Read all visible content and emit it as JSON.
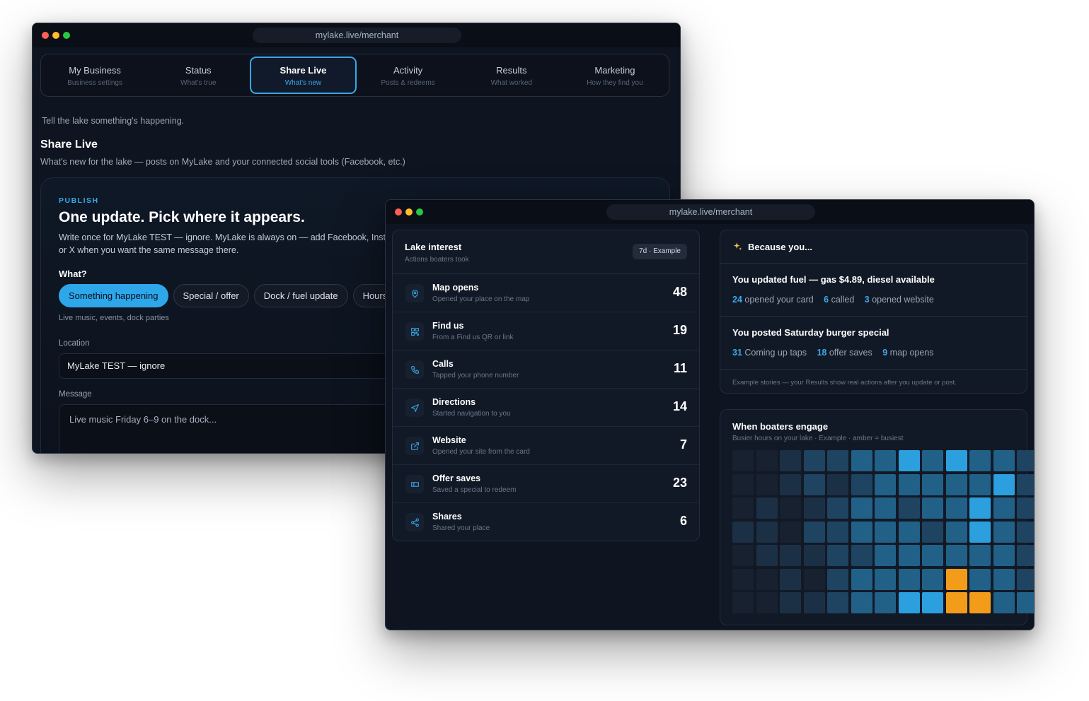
{
  "window1": {
    "url": "mylake.live/merchant",
    "tabs": [
      {
        "label": "My Business",
        "sub": "Business settings"
      },
      {
        "label": "Status",
        "sub": "What's true"
      },
      {
        "label": "Share Live",
        "sub": "What's new"
      },
      {
        "label": "Activity",
        "sub": "Posts & redeems"
      },
      {
        "label": "Results",
        "sub": "What worked"
      },
      {
        "label": "Marketing",
        "sub": "How they find you"
      }
    ],
    "active_tab": "Share Live",
    "tagline": "Tell the lake something's happening.",
    "title": "Share Live",
    "subtitle": "What's new for the lake — posts on MyLake and your connected social tools (Facebook, etc.)",
    "publish": {
      "kicker": "PUBLISH",
      "heading": "One update. Pick where it appears.",
      "desc_line1": "Write once for MyLake TEST — ignore. MyLake is always on — add Facebook, Insta",
      "desc_line2": "or X when you want the same message there.",
      "what_label": "What?",
      "chips": [
        "Something happening",
        "Special / offer",
        "Dock / fuel update",
        "Hours"
      ],
      "chip_hint": "Live music, events, dock parties",
      "location_label": "Location",
      "location_value": "MyLake TEST — ignore",
      "message_label": "Message",
      "message_placeholder": "Live music Friday 6–9 on the dock..."
    }
  },
  "window2": {
    "url": "mylake.live/merchant",
    "lake_interest": {
      "title": "Lake interest",
      "subtitle": "Actions boaters took",
      "badge": "7d · Example",
      "metrics": [
        {
          "icon": "map-pin-icon",
          "title": "Map opens",
          "sub": "Opened your place on the map",
          "value": "48"
        },
        {
          "icon": "qr-code-icon",
          "title": "Find us",
          "sub": "From a Find us QR or link",
          "value": "19"
        },
        {
          "icon": "phone-icon",
          "title": "Calls",
          "sub": "Tapped your phone number",
          "value": "11"
        },
        {
          "icon": "navigation-icon",
          "title": "Directions",
          "sub": "Started navigation to you",
          "value": "14"
        },
        {
          "icon": "external-link-icon",
          "title": "Website",
          "sub": "Opened your site from the card",
          "value": "7"
        },
        {
          "icon": "ticket-icon",
          "title": "Offer saves",
          "sub": "Saved a special to redeem",
          "value": "23"
        },
        {
          "icon": "share-icon",
          "title": "Shares",
          "sub": "Shared your place",
          "value": "6"
        }
      ]
    },
    "because": {
      "title": "Because you...",
      "stories": [
        {
          "title": "You updated fuel — gas $4.89, diesel available",
          "stats": [
            {
              "n": "24",
              "label": "opened your card"
            },
            {
              "n": "6",
              "label": "called"
            },
            {
              "n": "3",
              "label": "opened website"
            }
          ]
        },
        {
          "title": "You posted Saturday burger special",
          "stats": [
            {
              "n": "31",
              "label": "Coming up taps"
            },
            {
              "n": "18",
              "label": "offer saves"
            },
            {
              "n": "9",
              "label": "map opens"
            }
          ]
        }
      ],
      "footer": "Example stories — your Results show real actions after you update or post."
    },
    "engage": {
      "title": "When boaters engage",
      "subtitle": "Busier hours on your lake · Example · amber = busiest",
      "colors": {
        "0": "#111a27",
        "1": "#17212f",
        "2": "#1c3045",
        "3": "#1e4461",
        "4": "#226187",
        "5": "#2c9fde",
        "A": "#f39c1a"
      },
      "grid": [
        "1123344545443",
        "1123234444453",
        "1212344344543",
        "2213344434543",
        "1222334444443",
        "112134444A443",
        "112234455AA443"
      ]
    }
  }
}
